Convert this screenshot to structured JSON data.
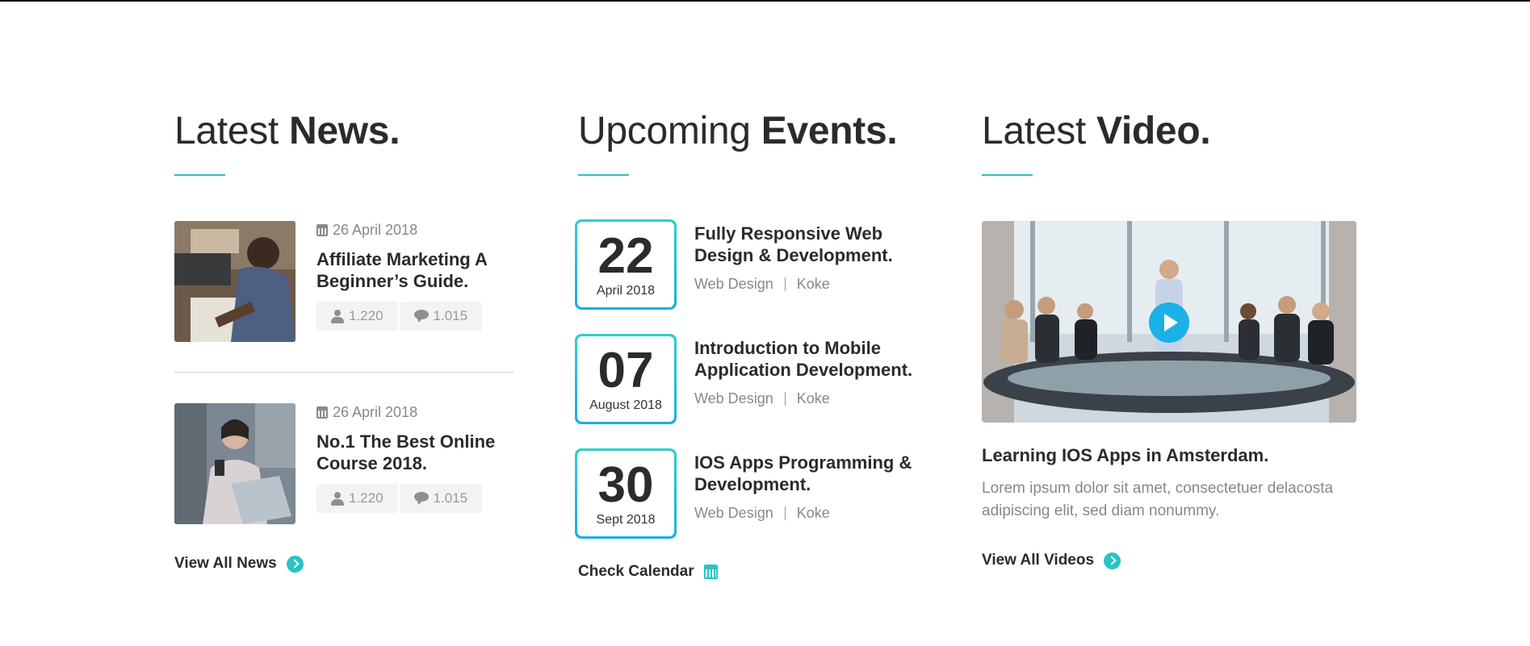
{
  "news": {
    "title_light": "Latest",
    "title_bold": "News.",
    "items": [
      {
        "date": "26 April 2018",
        "title": "Affiliate Marketing A Beginner’s Guide.",
        "views": "1.220",
        "comments": "1.015"
      },
      {
        "date": "26 April 2018",
        "title": "No.1 The Best Online Course 2018.",
        "views": "1.220",
        "comments": "1.015"
      }
    ],
    "view_all": "View All News"
  },
  "events": {
    "title_light": "Upcoming",
    "title_bold": "Events.",
    "items": [
      {
        "day": "22",
        "month": "April 2018",
        "title": "Fully Responsive Web Design & Development.",
        "category": "Web Design",
        "author": "Koke"
      },
      {
        "day": "07",
        "month": "August 2018",
        "title": "Introduction to Mobile Application Development.",
        "category": "Web Design",
        "author": "Koke"
      },
      {
        "day": "30",
        "month": "Sept 2018",
        "title": "IOS Apps Programming & Development.",
        "category": "Web Design",
        "author": "Koke"
      }
    ],
    "check_calendar": "Check Calendar"
  },
  "video": {
    "title_light": "Latest",
    "title_bold": "Video.",
    "video_title": "Learning IOS Apps in Amsterdam.",
    "description": "Lorem ipsum dolor sit amet, consectetuer delacosta adipiscing elit, sed diam nonummy.",
    "view_all": "View All Videos"
  },
  "colors": {
    "accent": "#29c4c4",
    "play_button": "#1ab1e8",
    "heading": "#2b2b2b",
    "muted": "#888888"
  }
}
